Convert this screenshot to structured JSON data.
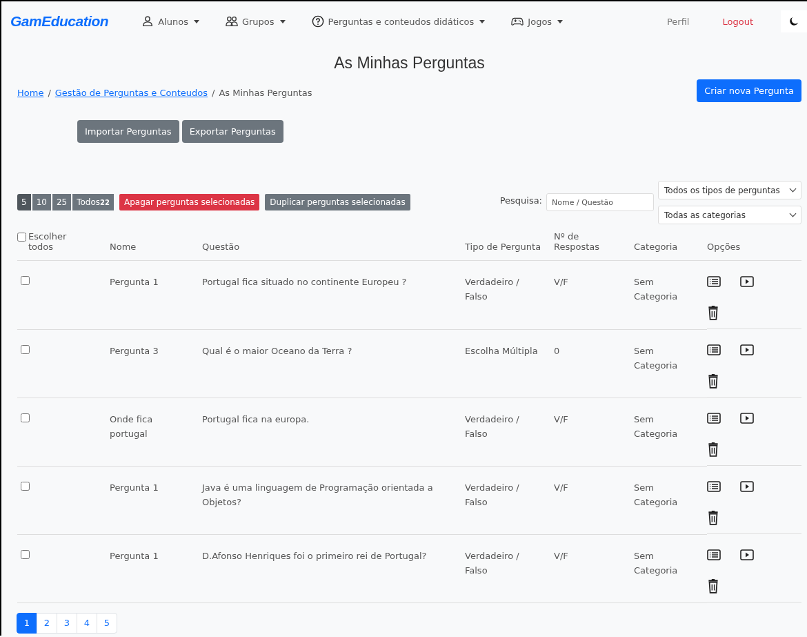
{
  "nav": {
    "brand": "GamEducation",
    "menus": [
      {
        "label": "Alunos",
        "kind": "person"
      },
      {
        "label": "Grupos",
        "kind": "people"
      },
      {
        "label": "Perguntas e conteudos didáticos",
        "kind": "question"
      },
      {
        "label": "Jogos",
        "kind": "controller"
      }
    ],
    "profile": "Perfil",
    "logout": "Logout"
  },
  "title": "As Minhas Perguntas",
  "breadcrumb": [
    {
      "label": "Home",
      "link": true
    },
    {
      "separator": "/",
      "label": "Gestão de Perguntas e Conteudos",
      "link": true
    },
    {
      "separator": "/",
      "label": "As Minhas Perguntas",
      "link": false
    }
  ],
  "create_button": "Criar nova Pergunta",
  "import_button": "Importar Perguntas",
  "export_button": "Exportar Perguntas",
  "page_sizes": [
    {
      "label": "5",
      "selected": true
    },
    {
      "label": "10",
      "selected": false
    },
    {
      "label": "25",
      "selected": false
    },
    {
      "label": "Todos",
      "count": "22",
      "selected": false
    }
  ],
  "delete_selected": "Apagar perguntas selecionadas",
  "duplicate_selected": "Duplicar perguntas selecionadas",
  "search": {
    "label": "Pesquisa:",
    "placeholder": "Nome / Questão"
  },
  "type_filter": "Todos os tipos de perguntas",
  "category_filter": "Todas as categorias",
  "table": {
    "select_all": {
      "label": "Escolher todos",
      "checked": false
    },
    "columns": [
      "Nome",
      "Questão",
      "Tipo de Pergunta",
      "Nº de Respostas",
      "Categoria",
      "Opções"
    ],
    "rows": [
      {
        "checked": false,
        "name": "Pergunta 1",
        "question": "Portugal fica situado no continente Europeu ?",
        "type": "Verdadeiro / Falso",
        "answers": "V/F",
        "category": "Sem Categoria"
      },
      {
        "checked": false,
        "name": "Pergunta 3",
        "question": "Qual é o maior Oceano da Terra ?",
        "type": "Escolha Múltipla",
        "answers": "0",
        "category": "Sem Categoria"
      },
      {
        "checked": false,
        "name": "Onde fica portugal",
        "question": "Portugal fica na europa.",
        "type": "Verdadeiro / Falso",
        "answers": "V/F",
        "category": "Sem Categoria"
      },
      {
        "checked": false,
        "name": "Pergunta 1",
        "question": "Java é uma linguagem de Programação orientada a Objetos?",
        "type": "Verdadeiro / Falso",
        "answers": "V/F",
        "category": "Sem Categoria"
      },
      {
        "checked": false,
        "name": "Pergunta 1",
        "question": "D.Afonso Henriques foi o primeiro rei de Portugal?",
        "type": "Verdadeiro / Falso",
        "answers": "V/F",
        "category": "Sem Categoria"
      }
    ]
  },
  "pagination": [
    {
      "label": "1",
      "selected": true
    },
    {
      "label": "2",
      "selected": false
    },
    {
      "label": "3",
      "selected": false
    },
    {
      "label": "4",
      "selected": false
    },
    {
      "label": "5",
      "selected": false
    }
  ]
}
